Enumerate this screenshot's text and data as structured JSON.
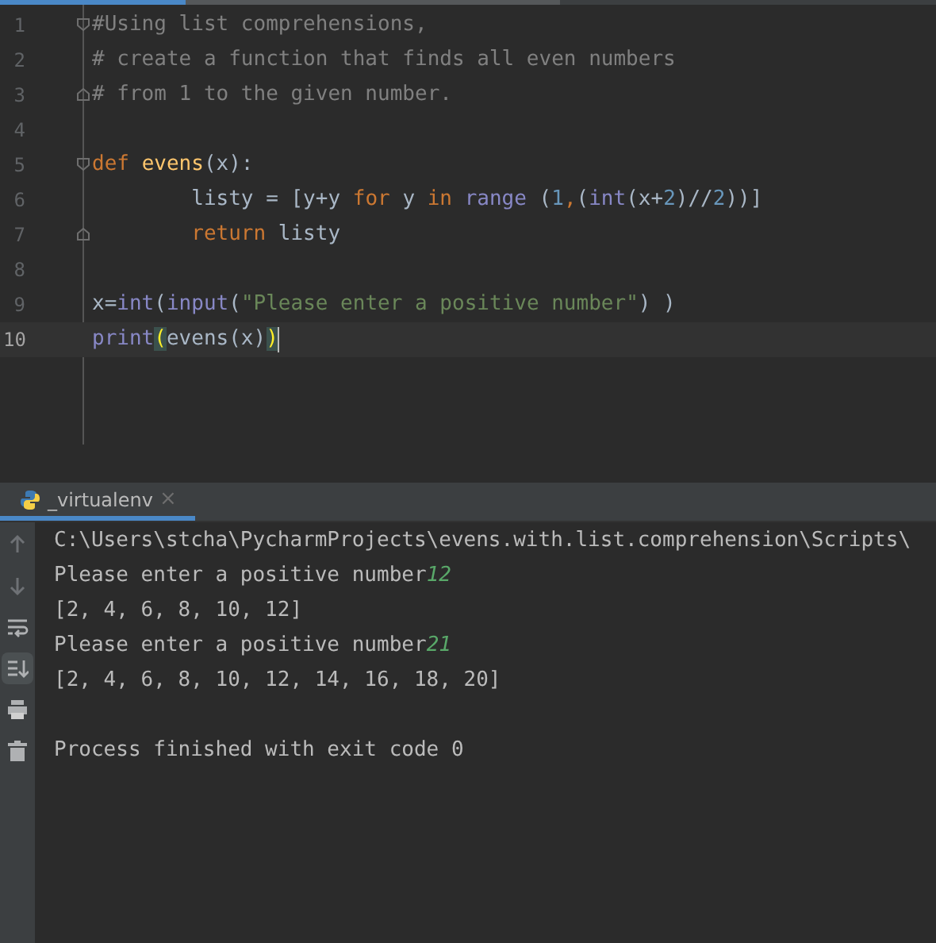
{
  "editor": {
    "lines": [
      {
        "number": "1",
        "current": false,
        "fold_start": true,
        "fold_end": false,
        "tokens": [
          {
            "text": "#Using list comprehensions,",
            "kind": "comment"
          }
        ]
      },
      {
        "number": "2",
        "current": false,
        "fold_start": false,
        "fold_end": false,
        "tokens": [
          {
            "text": "# create a function that finds all even numbers",
            "kind": "comment"
          }
        ]
      },
      {
        "number": "3",
        "current": false,
        "fold_start": false,
        "fold_end": true,
        "tokens": [
          {
            "text": "# from 1 to the given number.",
            "kind": "comment"
          }
        ]
      },
      {
        "number": "4",
        "current": false,
        "fold_start": false,
        "fold_end": false
      },
      {
        "number": "5",
        "current": false,
        "fold_start": true,
        "fold_end": false,
        "tokens": [
          {
            "text": "def ",
            "kind": "keyword"
          },
          {
            "text": "evens",
            "kind": "function"
          },
          {
            "text": "(x):",
            "kind": "plain"
          }
        ]
      },
      {
        "number": "6",
        "current": false,
        "fold_start": false,
        "fold_end": false,
        "tokens": [
          {
            "text": "        listy = [y+y ",
            "kind": "plain"
          },
          {
            "text": "for ",
            "kind": "keyword"
          },
          {
            "text": "y ",
            "kind": "plain"
          },
          {
            "text": "in ",
            "kind": "keyword"
          },
          {
            "text": "range ",
            "kind": "builtin"
          },
          {
            "text": "(",
            "kind": "plain"
          },
          {
            "text": "1",
            "kind": "number"
          },
          {
            "text": ",",
            "kind": "keyword"
          },
          {
            "text": "(",
            "kind": "plain"
          },
          {
            "text": "int",
            "kind": "builtin"
          },
          {
            "text": "(x+",
            "kind": "plain"
          },
          {
            "text": "2",
            "kind": "number"
          },
          {
            "text": ")//",
            "kind": "plain"
          },
          {
            "text": "2",
            "kind": "number"
          },
          {
            "text": "))]",
            "kind": "plain"
          }
        ]
      },
      {
        "number": "7",
        "current": false,
        "fold_start": false,
        "fold_end": true,
        "tokens": [
          {
            "text": "        return ",
            "kind": "keyword"
          },
          {
            "text": "listy",
            "kind": "plain"
          }
        ]
      },
      {
        "number": "8",
        "current": false,
        "fold_start": false,
        "fold_end": false
      },
      {
        "number": "9",
        "current": false,
        "fold_start": false,
        "fold_end": false,
        "tokens": [
          {
            "text": "x=",
            "kind": "plain"
          },
          {
            "text": "int",
            "kind": "builtin"
          },
          {
            "text": "(",
            "kind": "plain"
          },
          {
            "text": "input",
            "kind": "builtin"
          },
          {
            "text": "(",
            "kind": "plain"
          },
          {
            "text": "\"Please enter a positive number\"",
            "kind": "string"
          },
          {
            "text": ") )",
            "kind": "plain"
          }
        ]
      },
      {
        "number": "10",
        "current": true,
        "fold_start": false,
        "fold_end": false,
        "tokens": [
          {
            "text": "print",
            "kind": "builtin"
          },
          {
            "text": "(",
            "kind": "matched"
          },
          {
            "text": "evens(x)",
            "kind": "plain"
          },
          {
            "text": ")",
            "kind": "matched"
          }
        ]
      }
    ]
  },
  "run_panel": {
    "tab": {
      "label": "_virtualenv",
      "close": "×"
    },
    "toolbar": [
      {
        "kind": "up",
        "selected": false
      },
      {
        "kind": "down",
        "selected": false
      },
      {
        "kind": "wrap",
        "selected": false
      },
      {
        "kind": "scroll-end",
        "selected": true
      },
      {
        "kind": "print",
        "selected": false
      },
      {
        "kind": "trash",
        "selected": false
      }
    ],
    "console": [
      {
        "kind": "output",
        "segments": [
          {
            "text": "C:\\Users\\stcha\\PycharmProjects\\evens.with.list.comprehension\\Scripts\\",
            "kind": "output"
          }
        ]
      },
      {
        "kind": "output",
        "segments": [
          {
            "text": "Please enter a positive number",
            "kind": "output"
          },
          {
            "text": "12",
            "kind": "input"
          }
        ]
      },
      {
        "kind": "output",
        "segments": [
          {
            "text": "[2, 4, 6, 8, 10, 12]",
            "kind": "output"
          }
        ]
      },
      {
        "kind": "output",
        "segments": [
          {
            "text": "Please enter a positive number",
            "kind": "output"
          },
          {
            "text": "21",
            "kind": "input"
          }
        ]
      },
      {
        "kind": "output",
        "segments": [
          {
            "text": "[2, 4, 6, 8, 10, 12, 14, 16, 18, 20]",
            "kind": "output"
          }
        ]
      },
      {
        "kind": "status",
        "segments": [
          {
            "text": "Process finished with exit code 0",
            "kind": "output"
          }
        ]
      }
    ]
  }
}
